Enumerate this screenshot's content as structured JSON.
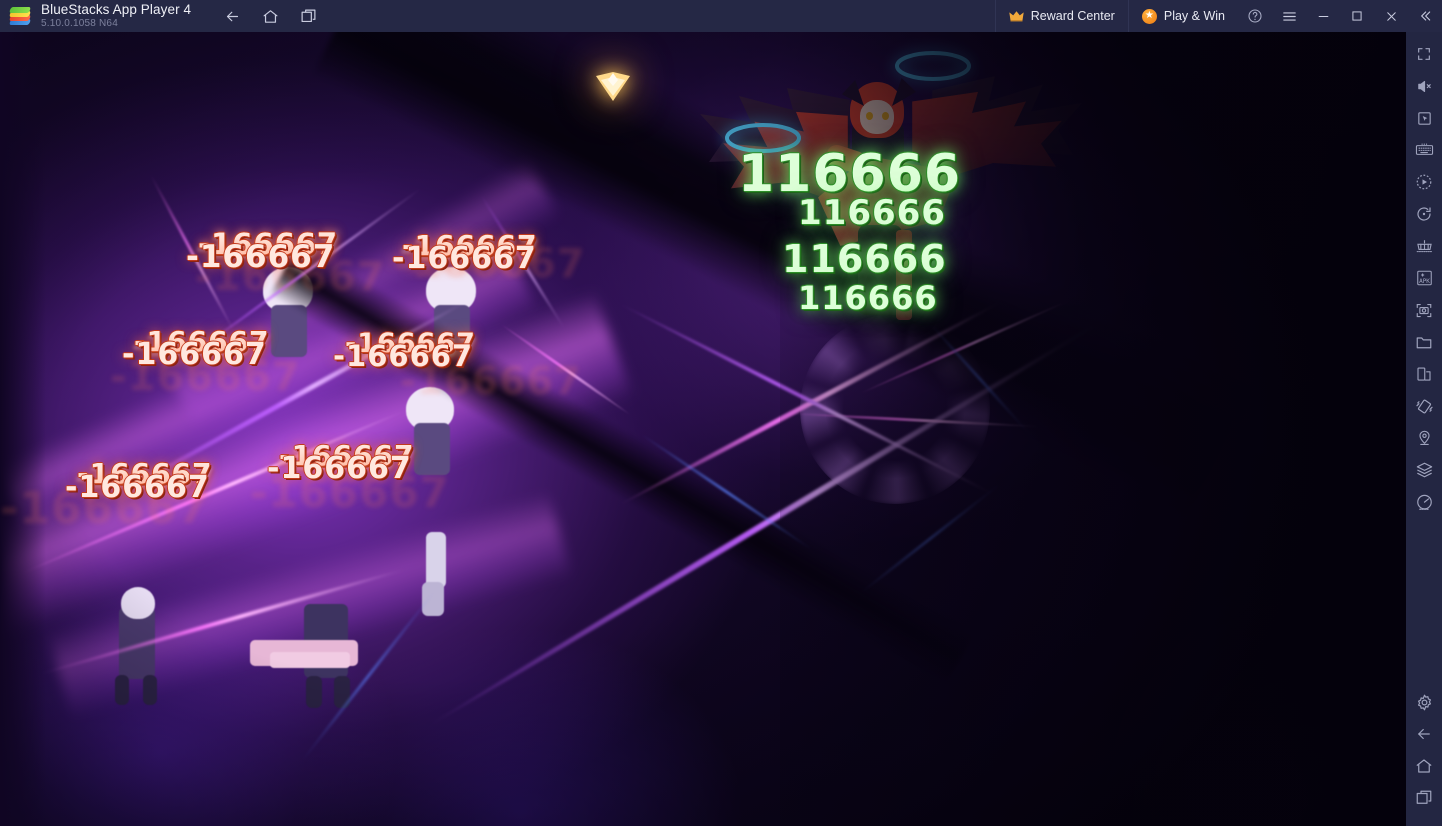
{
  "window": {
    "app_title": "BlueStacks App Player 4",
    "app_version": "5.10.0.1058  N64",
    "logo_icon": "bluestacks-logo"
  },
  "titlebar": {
    "nav": [
      {
        "name": "back-icon",
        "label": "Back"
      },
      {
        "name": "home-icon",
        "label": "Home"
      },
      {
        "name": "recents-icon",
        "label": "Recent apps"
      }
    ],
    "reward_center": {
      "label": "Reward Center",
      "icon": "crown-icon"
    },
    "play_and_win": {
      "label": "Play & Win",
      "icon": "star-badge-icon"
    },
    "controls": [
      {
        "name": "help-icon",
        "label": "Help"
      },
      {
        "name": "menu-icon",
        "label": "Menu"
      },
      {
        "name": "minimize-icon",
        "label": "Minimize"
      },
      {
        "name": "maximize-icon",
        "label": "Maximize"
      },
      {
        "name": "close-icon",
        "label": "Close"
      },
      {
        "name": "collapse-icon",
        "label": "Collapse sidebar"
      }
    ]
  },
  "sidebar": {
    "top_items": [
      {
        "name": "fullscreen-icon",
        "label": "Full screen"
      },
      {
        "name": "mute-icon",
        "label": "Mute"
      },
      {
        "name": "cursor-icon",
        "label": "Cursor"
      },
      {
        "name": "keyboard-controls-icon",
        "label": "Game controls"
      },
      {
        "name": "macro-recorder-icon",
        "label": "Macro recorder"
      },
      {
        "name": "rotate-icon",
        "label": "Rotate"
      },
      {
        "name": "multi-instance-icon",
        "label": "Multi-instance manager"
      },
      {
        "name": "install-apk-icon",
        "label": "Install APK"
      },
      {
        "name": "screenshot-icon",
        "label": "Screenshot"
      },
      {
        "name": "media-manager-icon",
        "label": "Media manager"
      },
      {
        "name": "multi-window-icon",
        "label": "Multi window"
      },
      {
        "name": "shake-icon",
        "label": "Shake"
      },
      {
        "name": "location-icon",
        "label": "Location"
      },
      {
        "name": "layers-icon",
        "label": "Eco mode"
      },
      {
        "name": "performance-icon",
        "label": "Performance"
      }
    ],
    "bottom_items": [
      {
        "name": "settings-gear-icon",
        "label": "Settings"
      },
      {
        "name": "back-icon",
        "label": "Back"
      },
      {
        "name": "home-icon",
        "label": "Home"
      },
      {
        "name": "recents-icon",
        "label": "Recent apps"
      }
    ]
  },
  "game": {
    "scene": "battle-combat-scene",
    "marker_icon": "target-chevron-marker",
    "boss": {
      "name": "demon-winged-boss-character",
      "hair_color": "#e0452f",
      "halo_color": "#3fc6ff"
    },
    "damage_numbers_green": [
      "116666",
      "116666",
      "116666",
      "116666"
    ],
    "damage_numbers_red": [
      "-166667",
      "-166667",
      "-166667",
      "-166667",
      "-166667",
      "-166667"
    ],
    "colors": {
      "green_damage": "#ddffd8",
      "green_outline": "#2f8f2a",
      "red_damage": "#ffe8df",
      "red_outline": "#c23a1c",
      "beam_magenta": "#ff78ff",
      "beam_violet": "#be5fff",
      "marker_gold": "#ffc85a"
    }
  },
  "theme": {
    "titlebar_bg": "#252845",
    "sidebar_bg": "#232642",
    "text_primary": "#f0f1f7",
    "text_secondary": "#7d819d"
  }
}
